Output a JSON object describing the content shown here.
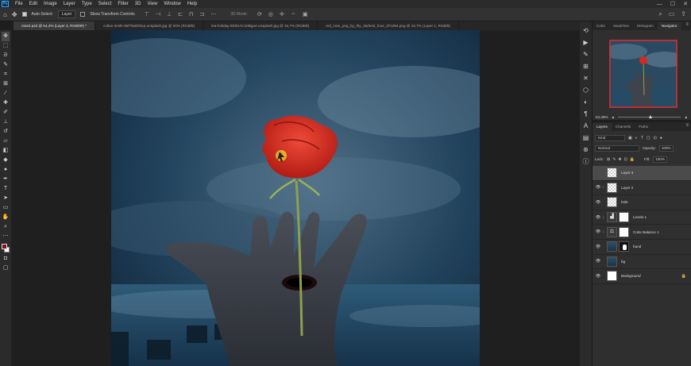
{
  "app": {
    "logo": "Ps"
  },
  "menu": [
    "File",
    "Edit",
    "Image",
    "Layer",
    "Type",
    "Select",
    "Filter",
    "3D",
    "View",
    "Window",
    "Help"
  ],
  "options_bar": {
    "auto_select_label": "Auto-Select:",
    "auto_select_checked": true,
    "target_value": "Layer",
    "transform_controls_label": "Show Transform Controls",
    "mode_label": "3D Mode:"
  },
  "tabs": [
    "rose2.psd @ 54,4% (Layer 3, RGB/8#) *",
    "colton-smith-8sf7ls8Ohtxp-unsplash.jpg @ 50% (RGB/8)",
    "tea-holiday-8S9XACo0Bga4-unsplash.jpg @ 16,7% (RGB/8)",
    "red_rose_png_by_thy_darkest_hour_d7cd64.png @ 16,7% (Layer 1, RGB/8)"
  ],
  "navigator": {
    "tabs": [
      "Color",
      "Swatches",
      "Histogram",
      "Navigator"
    ],
    "active_tab": "Navigator",
    "zoom": "54,38%",
    "zoom_fraction": 0.49
  },
  "layers_panel": {
    "tabs": [
      "Layers",
      "Channels",
      "Paths"
    ],
    "active_tab": "Layers",
    "kind_label": "Kind",
    "blend_mode": "Normal",
    "opacity_label": "Opacity:",
    "opacity_value": "100%",
    "lock_label": "Lock:",
    "fill_label": "Fill:",
    "fill_value": "100%",
    "layers": [
      {
        "name": "Layer 3",
        "visible": false,
        "active": true,
        "clipped": false,
        "thumb": "checker",
        "mask": "",
        "italic": false,
        "locked": false
      },
      {
        "name": "Layer 2",
        "visible": true,
        "active": false,
        "clipped": true,
        "thumb": "checker",
        "mask": "",
        "italic": false,
        "locked": false
      },
      {
        "name": "hole",
        "visible": true,
        "active": false,
        "clipped": false,
        "thumb": "checker",
        "mask": "",
        "italic": false,
        "locked": false
      },
      {
        "name": "Levels 1",
        "visible": true,
        "active": false,
        "clipped": true,
        "thumb": "levels",
        "mask": "white",
        "italic": false,
        "locked": false
      },
      {
        "name": "Color Balance 1",
        "visible": true,
        "active": false,
        "clipped": true,
        "thumb": "balance",
        "mask": "white",
        "italic": false,
        "locked": false
      },
      {
        "name": "hand",
        "visible": true,
        "active": false,
        "clipped": false,
        "thumb": "photo",
        "mask": "dark",
        "italic": false,
        "locked": false
      },
      {
        "name": "bg",
        "visible": true,
        "active": false,
        "clipped": false,
        "thumb": "photo",
        "mask": "",
        "italic": false,
        "locked": false
      },
      {
        "name": "Background",
        "visible": true,
        "active": false,
        "clipped": false,
        "thumb": "white",
        "mask": "",
        "italic": true,
        "locked": true
      }
    ]
  },
  "colors": {
    "foreground": "#8f0f16",
    "background": "#ffffff",
    "rose": "#d42a1e",
    "sky": "#1d3d56"
  }
}
